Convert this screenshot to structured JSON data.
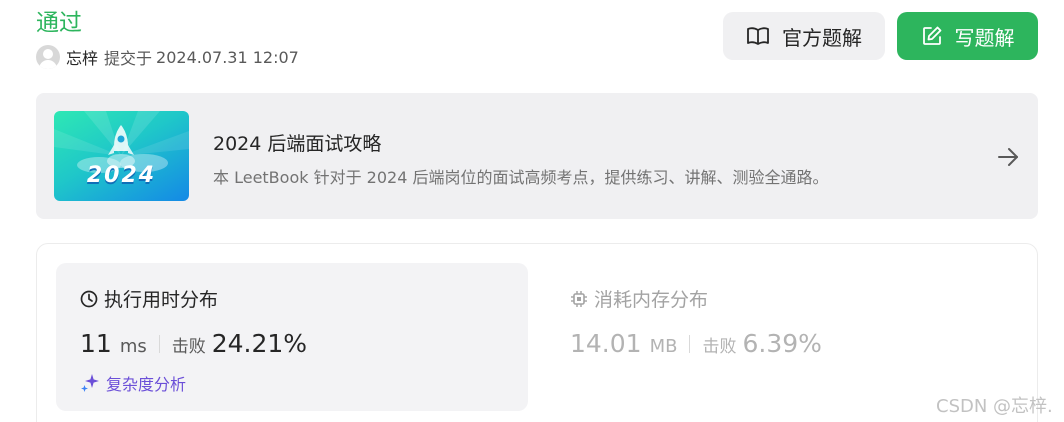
{
  "submission": {
    "status": "通过",
    "author": "忘梓",
    "submitted_label": "提交于",
    "submitted_time": "2024.07.31 12:07"
  },
  "actions": {
    "official_solution_label": "官方题解",
    "write_solution_label": "写题解"
  },
  "leetbook": {
    "cover_text": "2024",
    "title": "2024 后端面试攻略",
    "description": "本 LeetBook 针对于 2024 后端岗位的面试高频考点，提供练习、讲解、测验全通路。"
  },
  "runtime": {
    "title": "执行用时分布",
    "value": "11",
    "unit": "ms",
    "beat_label": "击败",
    "beat_percent": "24.21%",
    "complexity_label": "复杂度分析"
  },
  "memory": {
    "title": "消耗内存分布",
    "value": "14.01",
    "unit": "MB",
    "beat_label": "击败",
    "beat_percent": "6.39%"
  },
  "watermark": "CSDN @忘梓.",
  "colors": {
    "accent_green": "#2db55d",
    "complexity_purple": "#6b4fd8",
    "muted_gray": "#b3b3b3"
  },
  "icons": {
    "official_solution": "book-icon",
    "write_solution": "edit-icon",
    "banner_arrow": "arrow-right-icon",
    "runtime": "clock-icon",
    "memory": "chip-icon",
    "complexity": "sparkle-icon"
  }
}
